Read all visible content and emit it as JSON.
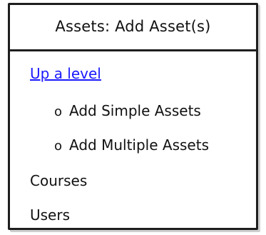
{
  "header": {
    "title": "Assets: Add Asset(s)"
  },
  "nav": {
    "up_level": "Up a level",
    "sub_items": [
      {
        "bullet": "o",
        "label": "Add Simple Assets"
      },
      {
        "bullet": "o",
        "label": "Add Multiple Assets"
      }
    ],
    "courses": "Courses",
    "users": "Users"
  },
  "colors": {
    "link": "#1a1aff",
    "border": "#1e1e1e"
  }
}
